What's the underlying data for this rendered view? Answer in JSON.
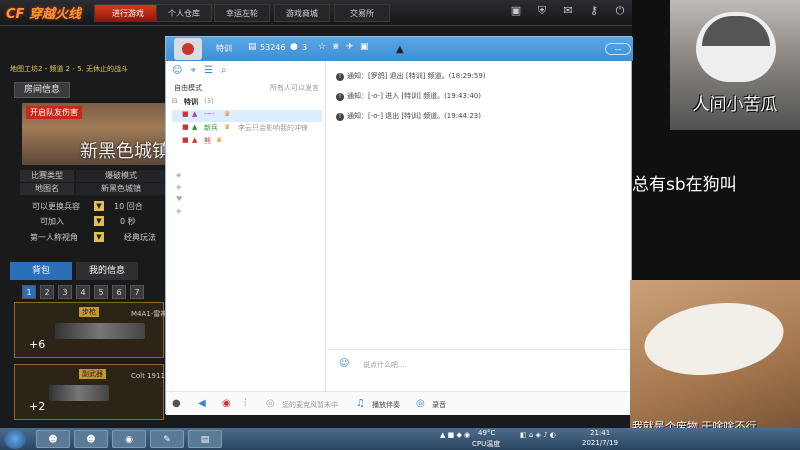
{
  "game": {
    "logo": "CF 穿越火线",
    "nav": [
      "进行游戏",
      "个人仓库",
      "幸运左轮",
      "游戏商城",
      "交易所"
    ],
    "marquee": "地图工坊2 - 频道 2 - 5. 无休止的战斗",
    "room_info_label": "房间信息",
    "warning_label": "开启队友伤害",
    "map_name": "新黑色城镇",
    "info_rows": [
      {
        "key": "比赛类型",
        "value": "爆破模式"
      },
      {
        "key": "地图名",
        "value": "新黑色城镇"
      }
    ],
    "options": [
      {
        "a": "可以更换兵容",
        "b": "10 回合"
      },
      {
        "a": "可加入",
        "b": "0 秒"
      },
      {
        "a": "第一人称视角",
        "b": "经典玩法"
      }
    ],
    "tab_backpack": "背包",
    "tab_myinfo": "我的信息",
    "pages": [
      "1",
      "2",
      "3",
      "4",
      "5",
      "6",
      "7"
    ],
    "weapon1": {
      "tag": "步枪",
      "name": "M4A1-雷神",
      "plus": "+6"
    },
    "weapon2": {
      "tag": "副武器",
      "name": "Colt 1911-天",
      "plus": "+2"
    }
  },
  "chat": {
    "title_name": "特训",
    "room_id": "53246",
    "member_count": "3",
    "min_label": "—",
    "mode_label": "自由模式",
    "mode_hint": "所有人可以发言",
    "channel": "特训",
    "channel_count": "(3)",
    "members": [
      {
        "name": "-~-",
        "note": ""
      },
      {
        "name": "新兵",
        "note": "李云只会影响我的冲锋"
      },
      {
        "name": "熊",
        "note": ""
      }
    ],
    "messages": [
      {
        "text": "通知：[罗鸽] 退出 [特训] 频道。(18:29:59)"
      },
      {
        "text": "通知：[-o-] 进入 [特训] 频道。(19:43:40)"
      },
      {
        "text": "通知：[-o-] 退出 [特训] 频道。(19:44:23)"
      }
    ],
    "input_placeholder": "说点什么吧...",
    "mic_hint": "您的麦克风暂未中",
    "music_label": "播放伴奏",
    "record_label": "录音"
  },
  "taskbar": {
    "temp": "49°C",
    "cpu": "CPU温度",
    "time": "21:41",
    "date": "2021/7/19"
  },
  "overlay": {
    "dog_caption": "人间小苦瓜",
    "side_text": "总有sb在狗叫",
    "cat_caption": "我就是个废物 干啥啥不行"
  }
}
